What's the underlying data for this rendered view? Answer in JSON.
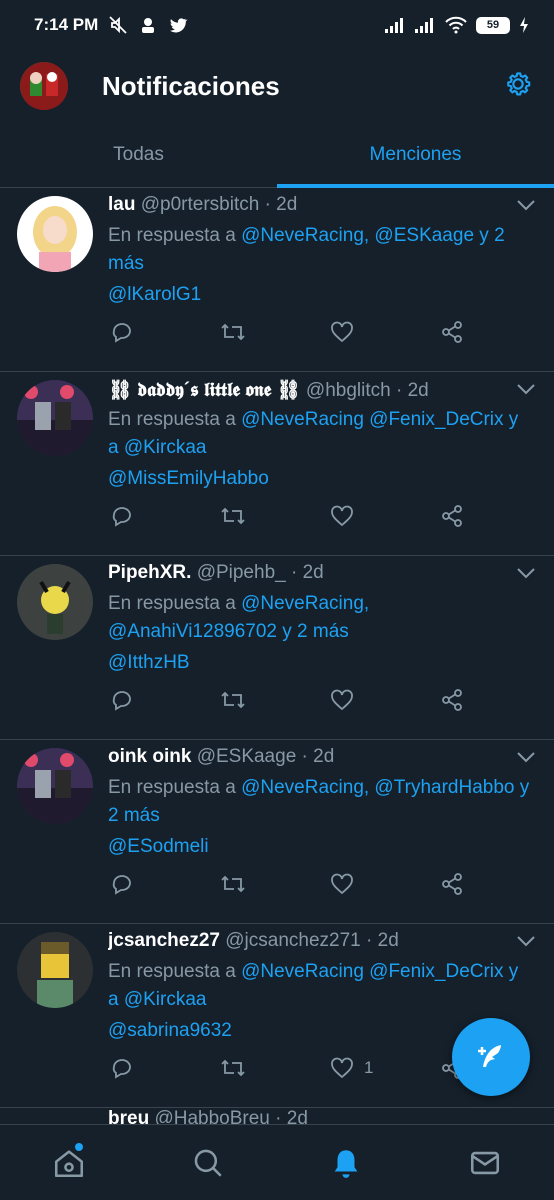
{
  "status_bar": {
    "time": "7:14 PM",
    "battery": "59",
    "icons": [
      "mute-icon",
      "app-icon",
      "twitter-bird-icon",
      "signal-icon",
      "signal-icon",
      "wifi-icon",
      "battery-icon",
      "charging-icon"
    ]
  },
  "header": {
    "title": "Notificaciones"
  },
  "tabs": [
    {
      "label": "Todas",
      "active": false
    },
    {
      "label": "Menciones",
      "active": true
    }
  ],
  "tweets": [
    {
      "name": "lau",
      "handle": "@p0rtersbitch",
      "time": "· 2d",
      "reply_prefix": "En respuesta a ",
      "reply_mentions": "@NeveRacing, @ESKaage y 2 más",
      "mention": "@lKarolG1",
      "like_count": ""
    },
    {
      "name": "⛓ 𝖉𝖆𝖉𝖉𝖞´𝖘 𝖑𝖎𝖙𝖙𝖑𝖊 𝖔𝖓𝖊 ⛓",
      "handle": "@hbglitch",
      "time": "· 2d",
      "reply_prefix": "En respuesta a ",
      "reply_mentions": "@NeveRacing @Fenix_DeCrix y a @Kirckaa",
      "mention": "@MissEmilyHabbo",
      "like_count": ""
    },
    {
      "name": "PipehXR.",
      "handle": "@Pipehb_",
      "time": "· 2d",
      "reply_prefix": "En respuesta a ",
      "reply_mentions": "@NeveRacing, @AnahiVi12896702 y 2 más",
      "mention": "@ItthzHB",
      "like_count": ""
    },
    {
      "name": "oink oink",
      "handle": "@ESKaage",
      "time": "· 2d",
      "reply_prefix": "En respuesta a ",
      "reply_mentions": "@NeveRacing, @TryhardHabbo y 2 más",
      "mention": "@ESodmeli",
      "like_count": ""
    },
    {
      "name": "jcsanchez27",
      "handle": "@jcsanchez271",
      "time": "· 2d",
      "reply_prefix": "En respuesta a ",
      "reply_mentions": "@NeveRacing @Fenix_DeCrix y a @Kirckaa",
      "mention": "@sabrina9632",
      "like_count": "1"
    }
  ],
  "partial_tweet": {
    "name": "breu",
    "handle": "@HabboBreu",
    "time": "· 2d"
  },
  "colors": {
    "background": "#15202b",
    "accent": "#1da1f2",
    "muted": "#8899a6",
    "divider": "#38444d"
  }
}
